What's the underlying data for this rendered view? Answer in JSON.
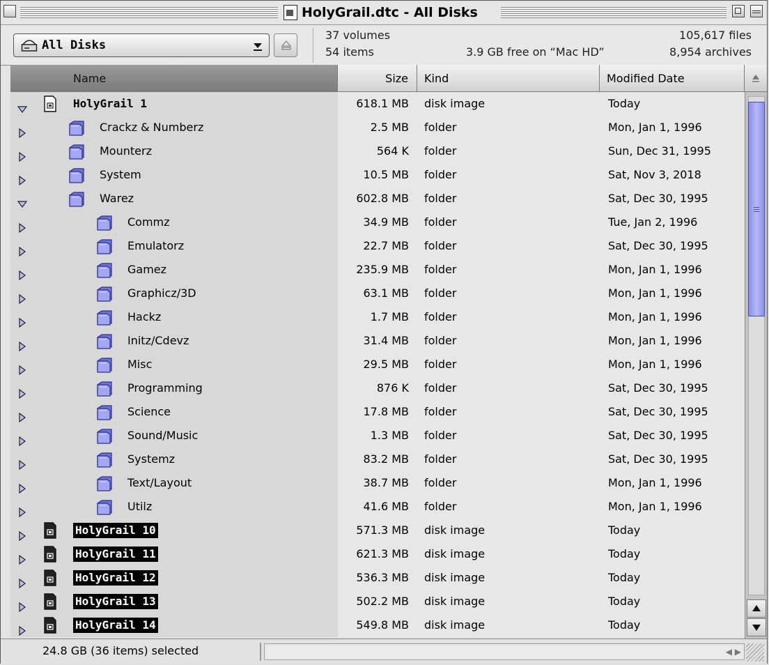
{
  "window": {
    "title": "HolyGrail.dtc - All Disks"
  },
  "header": {
    "disk_popup_label": "All Disks",
    "volumes": "37 volumes",
    "items": "54 items",
    "free_space": "3.9 GB free on “Mac HD”",
    "files": "105,617 files",
    "archives": "8,954 archives"
  },
  "columns": {
    "name": "Name",
    "size": "Size",
    "kind": "Kind",
    "date": "Modified Date"
  },
  "rows": [
    {
      "name": "HolyGrail 1",
      "size": "618.1 MB",
      "kind": "disk image",
      "date": "Today",
      "level": 0,
      "expanded": true,
      "icon": "disk-image-icon",
      "style": "bold"
    },
    {
      "name": "Crackz & Numberz",
      "size": "2.5 MB",
      "kind": "folder",
      "date": "Mon, Jan 1, 1996",
      "level": 1,
      "expanded": false,
      "icon": "folder-icon",
      "style": "normal"
    },
    {
      "name": "Mounterz",
      "size": "564 K",
      "kind": "folder",
      "date": "Sun, Dec 31, 1995",
      "level": 1,
      "expanded": false,
      "icon": "folder-icon",
      "style": "normal"
    },
    {
      "name": "System",
      "size": "10.5 MB",
      "kind": "folder",
      "date": "Sat, Nov 3, 2018",
      "level": 1,
      "expanded": false,
      "icon": "folder-icon",
      "style": "normal"
    },
    {
      "name": "Warez",
      "size": "602.8 MB",
      "kind": "folder",
      "date": "Sat, Dec 30, 1995",
      "level": 1,
      "expanded": true,
      "icon": "folder-icon",
      "style": "normal"
    },
    {
      "name": "Commz",
      "size": "34.9 MB",
      "kind": "folder",
      "date": "Tue, Jan 2, 1996",
      "level": 2,
      "expanded": false,
      "icon": "folder-icon",
      "style": "normal"
    },
    {
      "name": "Emulatorz",
      "size": "22.7 MB",
      "kind": "folder",
      "date": "Sat, Dec 30, 1995",
      "level": 2,
      "expanded": false,
      "icon": "folder-icon",
      "style": "normal"
    },
    {
      "name": "Gamez",
      "size": "235.9 MB",
      "kind": "folder",
      "date": "Mon, Jan 1, 1996",
      "level": 2,
      "expanded": false,
      "icon": "folder-icon",
      "style": "normal"
    },
    {
      "name": "Graphicz/3D",
      "size": "63.1 MB",
      "kind": "folder",
      "date": "Mon, Jan 1, 1996",
      "level": 2,
      "expanded": false,
      "icon": "folder-icon",
      "style": "normal"
    },
    {
      "name": "Hackz",
      "size": "1.7 MB",
      "kind": "folder",
      "date": "Mon, Jan 1, 1996",
      "level": 2,
      "expanded": false,
      "icon": "folder-icon",
      "style": "normal"
    },
    {
      "name": "Initz/Cdevz",
      "size": "31.4 MB",
      "kind": "folder",
      "date": "Mon, Jan 1, 1996",
      "level": 2,
      "expanded": false,
      "icon": "folder-icon",
      "style": "normal"
    },
    {
      "name": "Misc",
      "size": "29.5 MB",
      "kind": "folder",
      "date": "Mon, Jan 1, 1996",
      "level": 2,
      "expanded": false,
      "icon": "folder-icon",
      "style": "normal"
    },
    {
      "name": "Programming",
      "size": "876 K",
      "kind": "folder",
      "date": "Sat, Dec 30, 1995",
      "level": 2,
      "expanded": false,
      "icon": "folder-icon",
      "style": "normal"
    },
    {
      "name": "Science",
      "size": "17.8 MB",
      "kind": "folder",
      "date": "Sat, Dec 30, 1995",
      "level": 2,
      "expanded": false,
      "icon": "folder-icon",
      "style": "normal"
    },
    {
      "name": "Sound/Music",
      "size": "1.3 MB",
      "kind": "folder",
      "date": "Sat, Dec 30, 1995",
      "level": 2,
      "expanded": false,
      "icon": "folder-icon",
      "style": "normal"
    },
    {
      "name": "Systemz",
      "size": "83.2 MB",
      "kind": "folder",
      "date": "Sat, Dec 30, 1995",
      "level": 2,
      "expanded": false,
      "icon": "folder-icon",
      "style": "normal"
    },
    {
      "name": "Text/Layout",
      "size": "38.7 MB",
      "kind": "folder",
      "date": "Mon, Jan 1, 1996",
      "level": 2,
      "expanded": false,
      "icon": "folder-icon",
      "style": "normal"
    },
    {
      "name": "Utilz",
      "size": "41.6 MB",
      "kind": "folder",
      "date": "Mon, Jan 1, 1996",
      "level": 2,
      "expanded": false,
      "icon": "folder-icon",
      "style": "normal"
    },
    {
      "name": "HolyGrail 10",
      "size": "571.3 MB",
      "kind": "disk image",
      "date": "Today",
      "level": 0,
      "expanded": false,
      "icon": "disk-image-icon",
      "style": "selected"
    },
    {
      "name": "HolyGrail 11",
      "size": "621.3 MB",
      "kind": "disk image",
      "date": "Today",
      "level": 0,
      "expanded": false,
      "icon": "disk-image-icon",
      "style": "selected"
    },
    {
      "name": "HolyGrail 12",
      "size": "536.3 MB",
      "kind": "disk image",
      "date": "Today",
      "level": 0,
      "expanded": false,
      "icon": "disk-image-icon",
      "style": "selected"
    },
    {
      "name": "HolyGrail 13",
      "size": "502.2 MB",
      "kind": "disk image",
      "date": "Today",
      "level": 0,
      "expanded": false,
      "icon": "disk-image-icon",
      "style": "selected"
    },
    {
      "name": "HolyGrail 14",
      "size": "549.8 MB",
      "kind": "disk image",
      "date": "Today",
      "level": 0,
      "expanded": false,
      "icon": "disk-image-icon",
      "style": "selected"
    }
  ],
  "status": {
    "selection": "24.8 GB (36 items) selected"
  },
  "colors": {
    "selection_bg": "#000000",
    "folder": "#8f93e8",
    "scroll_thumb": "#9ea2f0"
  }
}
